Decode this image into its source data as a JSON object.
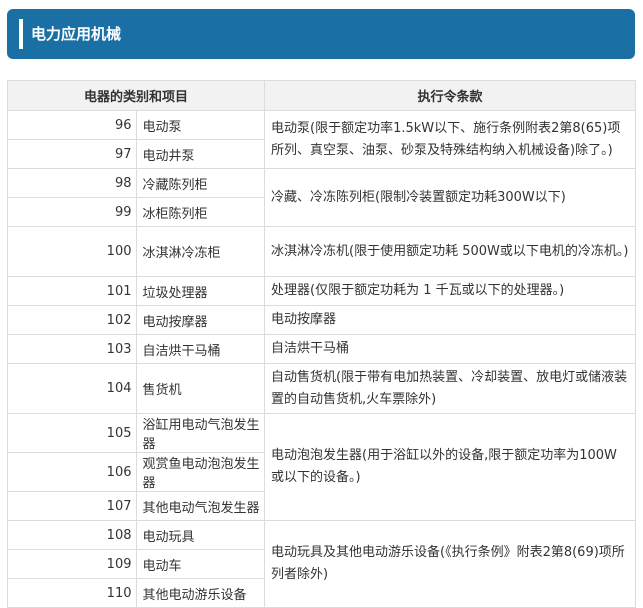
{
  "header": {
    "title": "电力应用机械"
  },
  "table": {
    "col_item": "电器的类别和项目",
    "col_clause": "执行令条款",
    "rows": [
      {
        "num": "96",
        "item": "电动泵"
      },
      {
        "num": "97",
        "item": "电动井泵"
      },
      {
        "num": "98",
        "item": "冷藏陈列柜"
      },
      {
        "num": "99",
        "item": "冰柜陈列柜"
      },
      {
        "num": "100",
        "item": "冰淇淋冷冻柜"
      },
      {
        "num": "101",
        "item": "垃圾处理器"
      },
      {
        "num": "102",
        "item": "电动按摩器"
      },
      {
        "num": "103",
        "item": "自洁烘干马桶"
      },
      {
        "num": "104",
        "item": "售货机"
      },
      {
        "num": "105",
        "item": "浴缸用电动气泡发生器"
      },
      {
        "num": "106",
        "item": "观赏鱼电动泡泡发生器"
      },
      {
        "num": "107",
        "item": "其他电动气泡发生器"
      },
      {
        "num": "108",
        "item": "电动玩具"
      },
      {
        "num": "109",
        "item": "电动车"
      },
      {
        "num": "110",
        "item": "其他电动游乐设备"
      }
    ],
    "clauses": {
      "c96": "电动泵(限于额定功率1.5kW以下、施行条例附表2第8(65)项所列、真空泵、油泵、砂泵及特殊结构纳入机械设备)除了。)",
      "c98": "冷藏、冷冻陈列柜(限制冷装置额定功耗300W以下)",
      "c100": "冰淇淋冷冻机(限于使用额定功耗 500W或以下电机的冷冻机。)",
      "c101": "处理器(仅限于额定功耗为 1 千瓦或以下的处理器。)",
      "c102": "电动按摩器",
      "c103": "自洁烘干马桶",
      "c104": "自动售货机(限于带有电加热装置、冷却装置、放电灯或储液装置的自动售货机,火车票除外)",
      "c105": "电动泡泡发生器(用于浴缸以外的设备,限于额定功率为100W或以下的设备。)",
      "c108": "电动玩具及其他电动游乐设备(《执行条例》附表2第8(69)项所列者除外)"
    }
  }
}
